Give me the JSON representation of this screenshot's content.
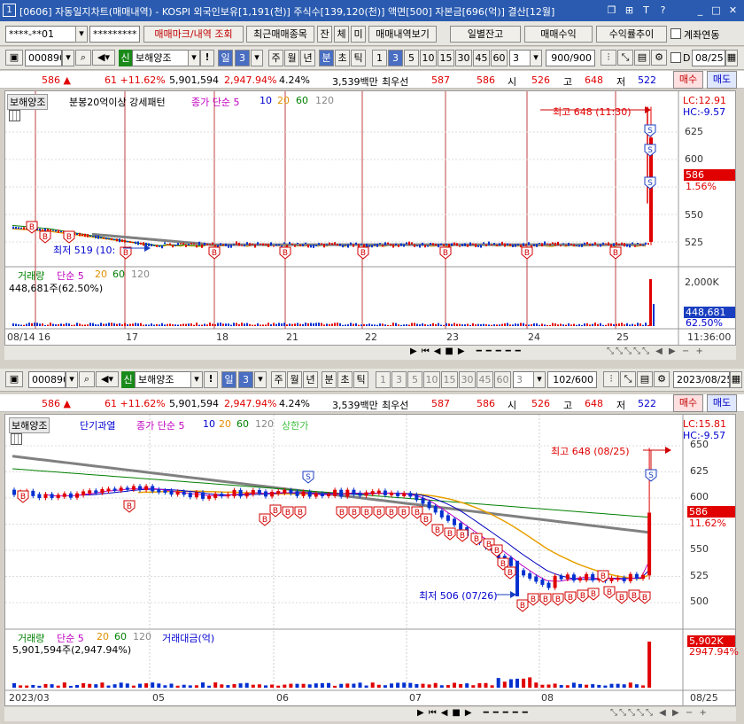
{
  "titlebar": {
    "num": "1",
    "text": "[0606] 자동일지차트(매매내역) - KOSPI 외국인보유[1,191(천)] 주식수[139,120(천)] 액면[500] 자본금[696(억)] 결산[12월]",
    "icons": [
      "restore-icon",
      "pin-icon",
      "help-icon",
      "minimize-icon",
      "maximize-icon",
      "close-icon"
    ],
    "icon_glyphs": [
      "❐",
      "⊞",
      "T",
      "?",
      "_",
      "□",
      "✕"
    ]
  },
  "toolbar1": {
    "account": "****-**01",
    "password": "*********",
    "btn_mark": "매매마크/내역 조회",
    "btn_recent": "최근매매종목",
    "btn_jan": "잔",
    "btn_che": "체",
    "btn_mi": "미",
    "btn_history": "매매내역보기",
    "btn_daily": "일별잔고",
    "btn_profit": "매매수익",
    "btn_rate": "수익률추이",
    "chk_link": "계좌연동"
  },
  "chart1": {
    "code": "000890",
    "market": "신",
    "name": "보해양조",
    "period_sel": "일",
    "period_num": "3",
    "periods": [
      "주",
      "월",
      "년",
      "분",
      "초",
      "틱"
    ],
    "minutes": [
      "1",
      "3",
      "5",
      "10",
      "15",
      "30",
      "45",
      "60"
    ],
    "active_min": "3",
    "unit": "3",
    "count": "900/900",
    "date_chk": "D",
    "date": "08/25",
    "quote": {
      "price": "586 ▲",
      "change": "61 +11.62%",
      "volume": "5,901,594",
      "vol_rate": "2,947.94%",
      "turnover": "4.24%",
      "amount": "3,539백만",
      "best_label": "최우선",
      "best1": "587",
      "best2": "586",
      "open_l": "시",
      "open": "526",
      "high_l": "고",
      "high": "648",
      "low_l": "저",
      "low": "522",
      "buy": "매수",
      "sell": "매도"
    },
    "legend": {
      "name": "보해양조",
      "pattern": "분봉20억이상 강세패턴",
      "ma": "종가 단순 5",
      "ma10": "10",
      "ma20": "20",
      "ma60": "60",
      "ma120": "120"
    },
    "lc": "LC:12.91",
    "hc": "HC:-9.57",
    "high_ann": "최고 648 (11:30)",
    "low_ann": "최저 519 (10:",
    "price_tag": "586",
    "price_pct": "1.56%",
    "yaxis": [
      "625",
      "600",
      "575",
      "550",
      "525"
    ],
    "vol_legend": {
      "label": "거래량",
      "ma": "단순 5",
      "ma20": "20",
      "ma60": "60",
      "ma120": "120",
      "value": "448,681주(62.50%)"
    },
    "vol_axis": "2,000K",
    "vol_tag": "448,681",
    "vol_pct": "62.50%",
    "xaxis": [
      "08/14",
      "16",
      "17",
      "18",
      "21",
      "22",
      "23",
      "24",
      "25"
    ],
    "time": "11:36:00"
  },
  "chart2": {
    "code": "000890",
    "market": "신",
    "name": "보해양조",
    "period_sel": "일",
    "period_num": "3",
    "periods": [
      "주",
      "월",
      "년",
      "분",
      "초",
      "틱"
    ],
    "minutes": [
      "1",
      "3",
      "5",
      "10",
      "15",
      "30",
      "45",
      "60"
    ],
    "unit": "3",
    "count": "102/600",
    "date": "2023/08/25",
    "quote": {
      "price": "586 ▲",
      "change": "61 +11.62%",
      "volume": "5,901,594",
      "vol_rate": "2,947.94%",
      "turnover": "4.24%",
      "amount": "3,539백만",
      "best_label": "최우선",
      "best1": "587",
      "best2": "586",
      "open_l": "시",
      "open": "526",
      "high_l": "고",
      "high": "648",
      "low_l": "저",
      "low": "522",
      "buy": "매수",
      "sell": "매도"
    },
    "legend": {
      "name": "보해양조",
      "pattern": "단기과열",
      "ma": "종가 단순 5",
      "ma10": "10",
      "ma20": "20",
      "ma60": "60",
      "ma120": "120",
      "limit": "상한가"
    },
    "lc": "LC:15.81",
    "hc": "HC:-9.57",
    "high_ann": "최고 648 (08/25)",
    "low_ann": "최저 506 (07/26)",
    "price_tag": "586",
    "price_pct": "11.62%",
    "yaxis": [
      "650",
      "625",
      "600",
      "575",
      "550",
      "525",
      "500"
    ],
    "vol_legend": {
      "label": "거래량",
      "ma": "단순 5",
      "ma20": "20",
      "ma60": "60",
      "ma120": "120",
      "amount": "거래대금(억)",
      "value": "5,901,594주(2,947.94%)"
    },
    "vol_tag": "5,902K",
    "vol_pct": "2947.94%",
    "xaxis": [
      "2023/03",
      "05",
      "06",
      "07",
      "08",
      "08/25"
    ]
  },
  "colors": {
    "up": "#e00000",
    "down": "#0030d0",
    "ma5": "#c000c0",
    "ma10": "#0000c0",
    "ma20": "#e8a000",
    "ma60": "#008000",
    "ma120": "#808080"
  }
}
